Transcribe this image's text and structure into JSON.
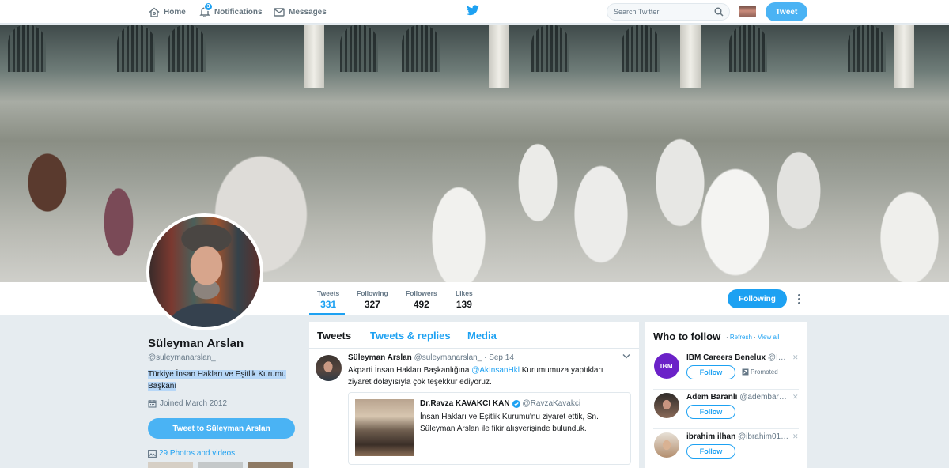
{
  "nav": {
    "home_label": "Home",
    "notifications_label": "Notifications",
    "notifications_count": "3",
    "messages_label": "Messages",
    "search_placeholder": "Search Twitter",
    "tweet_button": "Tweet",
    "home_icon": "home-icon",
    "notifications_icon": "bell-icon",
    "messages_icon": "envelope-icon",
    "logo_icon": "twitter-bird-icon",
    "search_icon": "magnifier-icon"
  },
  "profile": {
    "name": "Süleyman Arslan",
    "handle": "@suleymanarslan_",
    "bio": "Türkiye İnsan Hakları ve Eşitlik Kurumu Başkanı",
    "joined": "Joined March 2012",
    "tweet_to_button": "Tweet to Süleyman Arslan",
    "photos_link": "29 Photos and videos",
    "following_button": "Following"
  },
  "stats": [
    {
      "label": "Tweets",
      "value": "331"
    },
    {
      "label": "Following",
      "value": "327"
    },
    {
      "label": "Followers",
      "value": "492"
    },
    {
      "label": "Likes",
      "value": "139"
    }
  ],
  "timeline": {
    "tabs": [
      "Tweets",
      "Tweets & replies",
      "Media"
    ],
    "tweet": {
      "author": "Süleyman Arslan",
      "handle_date": "@suleymanarslan_ · Sep 14",
      "text_before": "Akparti İnsan Hakları Başkanlığına ",
      "mention": "@AkInsanHkl",
      "text_after": " Kurumumuza yaptıkları ziyaret dolayısıyla çok teşekkür ediyoruz.",
      "quote": {
        "author": "Dr.Ravza KAVAKCI KAN",
        "handle": "@RavzaKavakci",
        "text": "İnsan Hakları ve Eşitlik Kurumu'nu ziyaret ettik, Sn. Süleyman Arslan ile fikir alışverişinde bulunduk."
      }
    }
  },
  "who_to_follow": {
    "title": "Who to follow",
    "refresh": "Refresh",
    "view_all": "View all",
    "separator": "·",
    "follow_label": "Follow",
    "promoted_label": "Promoted",
    "accounts": [
      {
        "name": "IBM Careers Benelux",
        "handle": "@I…",
        "avatar_color": "#6b21c8",
        "avatar_text": "IBM",
        "promoted": true
      },
      {
        "name": "Adem Baranlı",
        "handle": "@adembar…",
        "avatar_color": "#8a6a58",
        "avatar_text": "",
        "promoted": false
      },
      {
        "name": "ibrahim ilhan",
        "handle": "@ibrahim01…",
        "avatar_color": "#b38e6e",
        "avatar_text": "",
        "promoted": false
      }
    ]
  },
  "colors": {
    "accent": "#1da1f2",
    "button": "#4ab3f4",
    "background": "#e6ecf0"
  }
}
